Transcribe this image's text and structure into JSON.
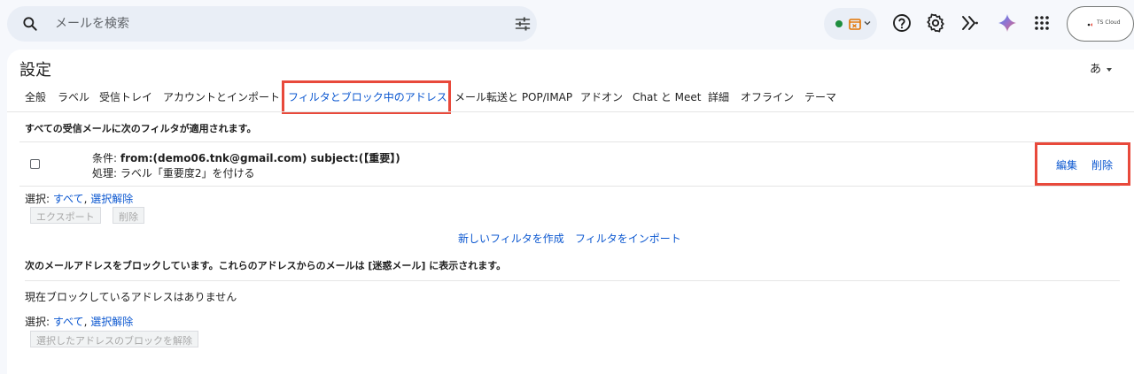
{
  "search": {
    "placeholder": "メールを検索"
  },
  "account": {
    "label": "TS Cloud"
  },
  "colors": {
    "accent": "#0b57d0",
    "highlight": "#e8493b",
    "status": "#1e8e3e"
  },
  "header": {
    "title": "設定",
    "input_method": "あ"
  },
  "tabs": [
    {
      "label": "全般"
    },
    {
      "label": "ラベル"
    },
    {
      "label": "受信トレイ"
    },
    {
      "label": "アカウントとインポート"
    },
    {
      "label": "フィルタとブロック中のアドレス",
      "active": true
    },
    {
      "label": "メール転送と POP/IMAP"
    },
    {
      "label": "アドオン"
    },
    {
      "label": "Chat と Meet"
    },
    {
      "label": "詳細"
    },
    {
      "label": "オフライン"
    },
    {
      "label": "テーマ"
    }
  ],
  "filters": {
    "heading": "すべての受信メールに次のフィルタが適用されます。",
    "rows": [
      {
        "condition_label": "条件:",
        "condition": "from:(demo06.tnk@gmail.com) subject:(【重要】)",
        "action": "処理: ラベル「重要度2」を付ける",
        "edit": "編集",
        "delete": "削除"
      }
    ],
    "select_label": "選択:",
    "select_all": "すべて",
    "comma": ",",
    "deselect": "選択解除",
    "export_button": "エクスポート",
    "delete_button": "削除",
    "create_link": "新しいフィルタを作成",
    "import_link": "フィルタをインポート"
  },
  "blocked": {
    "heading": "次のメールアドレスをブロックしています。これらのアドレスからのメールは [迷惑メール] に表示されます。",
    "empty_text": "現在ブロックしているアドレスはありません",
    "select_label": "選択:",
    "select_all": "すべて",
    "comma": ",",
    "deselect": "選択解除",
    "unblock_button": "選択したアドレスのブロックを解除"
  }
}
